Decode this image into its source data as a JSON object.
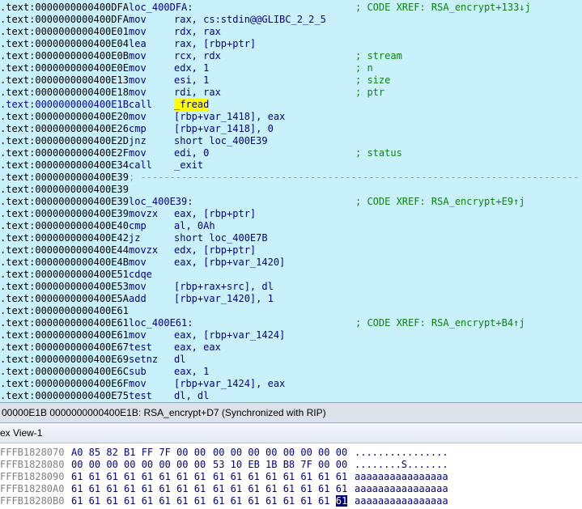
{
  "disasm": {
    "lines": [
      {
        "addr": ".text:0000000000400DFA",
        "label": "loc_400DFA:",
        "comment": "; CODE XREF: RSA_encrypt+133↓j"
      },
      {
        "addr": ".text:0000000000400DFA",
        "mnem": "mov",
        "ops": "rax, cs:stdin@@GLIBC_2_2_5"
      },
      {
        "addr": ".text:0000000000400E01",
        "mnem": "mov",
        "ops": "rdx, rax"
      },
      {
        "addr": ".text:0000000000400E04",
        "mnem": "lea",
        "ops": "rax, [rbp+ptr]"
      },
      {
        "addr": ".text:0000000000400E0B",
        "mnem": "mov",
        "ops": "rcx, rdx",
        "comment": "; stream"
      },
      {
        "addr": ".text:0000000000400E0E",
        "mnem": "mov",
        "ops": "edx, 1",
        "comment": "; n"
      },
      {
        "addr": ".text:0000000000400E13",
        "mnem": "mov",
        "ops": "esi, 1",
        "comment": "; size"
      },
      {
        "addr": ".text:0000000000400E18",
        "mnem": "mov",
        "ops": "rdi, rax",
        "comment": "; ptr"
      },
      {
        "addr": ".text:0000000000400E1B",
        "mnem": "call",
        "ops": "_fread",
        "current": true
      },
      {
        "addr": ".text:0000000000400E20",
        "mnem": "mov",
        "ops": "[rbp+var_1418], eax"
      },
      {
        "addr": ".text:0000000000400E26",
        "mnem": "cmp",
        "ops": "[rbp+var_1418], 0"
      },
      {
        "addr": ".text:0000000000400E2D",
        "mnem": "jnz",
        "ops": "short loc_400E39"
      },
      {
        "addr": ".text:0000000000400E2F",
        "mnem": "mov",
        "ops": "edi, 0",
        "comment": "; status"
      },
      {
        "addr": ".text:0000000000400E34",
        "mnem": "call",
        "ops": "_exit"
      },
      {
        "addr": ".text:0000000000400E39",
        "sep": "; ---------------------------------------------------------------------------"
      },
      {
        "addr": ".text:0000000000400E39"
      },
      {
        "addr": ".text:0000000000400E39",
        "label": "loc_400E39:",
        "comment": "; CODE XREF: RSA_encrypt+E9↑j"
      },
      {
        "addr": ".text:0000000000400E39",
        "mnem": "movzx",
        "ops": "eax, [rbp+ptr]"
      },
      {
        "addr": ".text:0000000000400E40",
        "mnem": "cmp",
        "ops": "al, 0Ah"
      },
      {
        "addr": ".text:0000000000400E42",
        "mnem": "jz",
        "ops": "short loc_400E7B"
      },
      {
        "addr": ".text:0000000000400E44",
        "mnem": "movzx",
        "ops": "edx, [rbp+ptr]"
      },
      {
        "addr": ".text:0000000000400E4B",
        "mnem": "mov",
        "ops": "eax, [rbp+var_1420]"
      },
      {
        "addr": ".text:0000000000400E51",
        "mnem": "cdqe"
      },
      {
        "addr": ".text:0000000000400E53",
        "mnem": "mov",
        "ops": "[rbp+rax+src], dl"
      },
      {
        "addr": ".text:0000000000400E5A",
        "mnem": "add",
        "ops": "[rbp+var_1420], 1"
      },
      {
        "addr": ".text:0000000000400E61"
      },
      {
        "addr": ".text:0000000000400E61",
        "label": "loc_400E61:",
        "comment": "; CODE XREF: RSA_encrypt+B4↑j"
      },
      {
        "addr": ".text:0000000000400E61",
        "mnem": "mov",
        "ops": "eax, [rbp+var_1424]"
      },
      {
        "addr": ".text:0000000000400E67",
        "mnem": "test",
        "ops": "eax, eax"
      },
      {
        "addr": ".text:0000000000400E69",
        "mnem": "setnz",
        "ops": "dl"
      },
      {
        "addr": ".text:0000000000400E6C",
        "mnem": "sub",
        "ops": "eax, 1"
      },
      {
        "addr": ".text:0000000000400E6F",
        "mnem": "mov",
        "ops": "[rbp+var_1424], eax"
      },
      {
        "addr": ".text:0000000000400E75",
        "mnem": "test",
        "ops": "dl, dl"
      }
    ]
  },
  "statusbar": {
    "text": "00000E1B 0000000000400E1B: RSA_encrypt+D7 (Synchronized with RIP)"
  },
  "hexview": {
    "title": "ex View-1",
    "rows": [
      {
        "addr": "FFFB1828070",
        "bytes1": "A0 85 82 B1 FF 7F 00 00",
        "bytes2": "00 00 00 00 00 00 00 00",
        "ascii": "................"
      },
      {
        "addr": "FFFB1828080",
        "bytes1": "00 00 00 00 00 00 00 00",
        "bytes2": "53 10 EB 1B B8 7F 00 00",
        "ascii": "........S......."
      },
      {
        "addr": "FFFB1828090",
        "bytes1": "61 61 61 61 61 61 61 61",
        "bytes2": "61 61 61 61 61 61 61 61",
        "ascii": "aaaaaaaaaaaaaaaa"
      },
      {
        "addr": "FFFB18280A0",
        "bytes1": "61 61 61 61 61 61 61 61",
        "bytes2": "61 61 61 61 61 61 61 61",
        "ascii": "aaaaaaaaaaaaaaaa"
      },
      {
        "addr": "FFFB18280B0",
        "bytes1": "61 61 61 61 61 61 61 61",
        "bytes2": "61 61 61 61 61 61 61",
        "bytes2_sel": "61",
        "ascii": "aaaaaaaaaaaaaaaa"
      }
    ]
  }
}
